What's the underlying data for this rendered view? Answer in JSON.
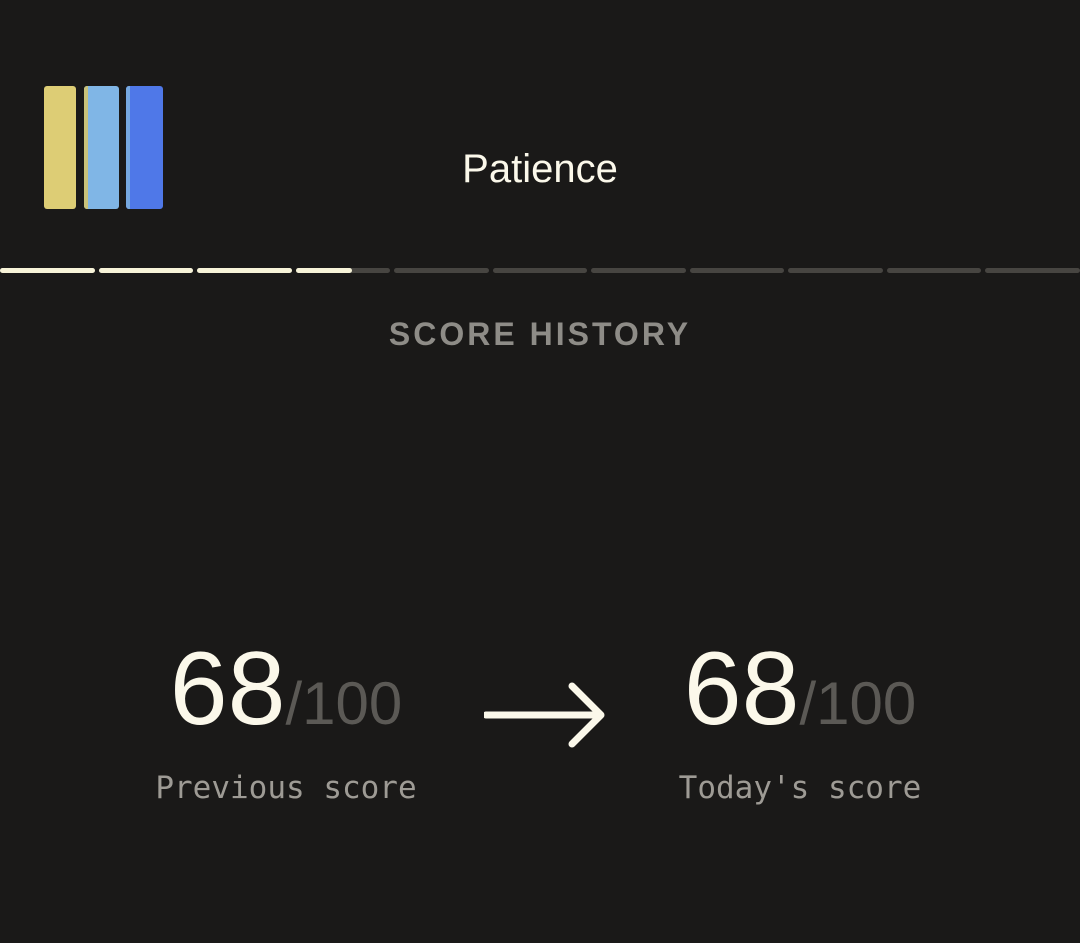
{
  "header": {
    "title": "Patience"
  },
  "logo": {
    "icon": "three-bar-logo-icon",
    "colors": [
      "#ddcd75",
      "#80b6e6",
      "#4f78e8"
    ]
  },
  "progress": {
    "segments_total": 11,
    "segments_completed": 3.6,
    "fill_color": "#f7f3d8",
    "track_color": "#474541"
  },
  "section": {
    "title": "SCORE HISTORY"
  },
  "scores": {
    "previous": {
      "value": "68",
      "max": "/100",
      "label": "Previous score"
    },
    "today": {
      "value": "68",
      "max": "/100",
      "label": "Today's score"
    },
    "arrow_icon": "arrow-right-icon"
  },
  "colors": {
    "background": "#1a1918",
    "primary_text": "#fbf8ea",
    "muted_text": "#8e8c87"
  }
}
